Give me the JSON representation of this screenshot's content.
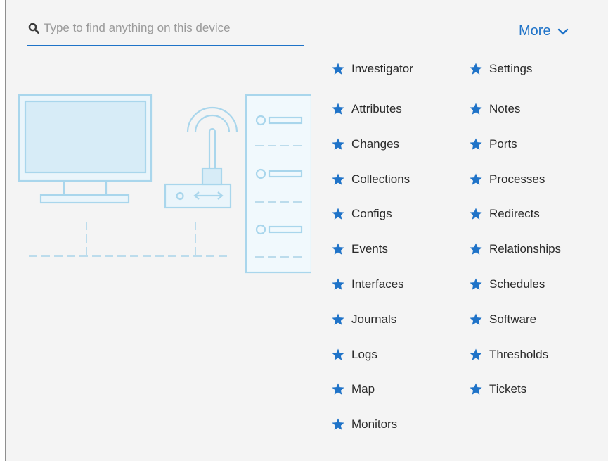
{
  "search": {
    "placeholder": "Type to find anything on this device",
    "value": ""
  },
  "more": {
    "label": "More"
  },
  "colors": {
    "accent": "#1f73c8",
    "illustration": "#a9d6ec",
    "panel": "#f4f4f4"
  },
  "top_links": [
    {
      "label": "Investigator",
      "icon": "star-icon"
    },
    {
      "label": "Settings",
      "icon": "star-icon"
    }
  ],
  "links_left": [
    {
      "label": "Attributes"
    },
    {
      "label": "Changes"
    },
    {
      "label": "Collections"
    },
    {
      "label": "Configs"
    },
    {
      "label": "Events"
    },
    {
      "label": "Interfaces"
    },
    {
      "label": "Journals"
    },
    {
      "label": "Logs"
    },
    {
      "label": "Map"
    },
    {
      "label": "Monitors"
    }
  ],
  "links_right": [
    {
      "label": "Notes"
    },
    {
      "label": "Ports"
    },
    {
      "label": "Processes"
    },
    {
      "label": "Redirects"
    },
    {
      "label": "Relationships"
    },
    {
      "label": "Schedules"
    },
    {
      "label": "Software"
    },
    {
      "label": "Thresholds"
    },
    {
      "label": "Tickets"
    }
  ]
}
